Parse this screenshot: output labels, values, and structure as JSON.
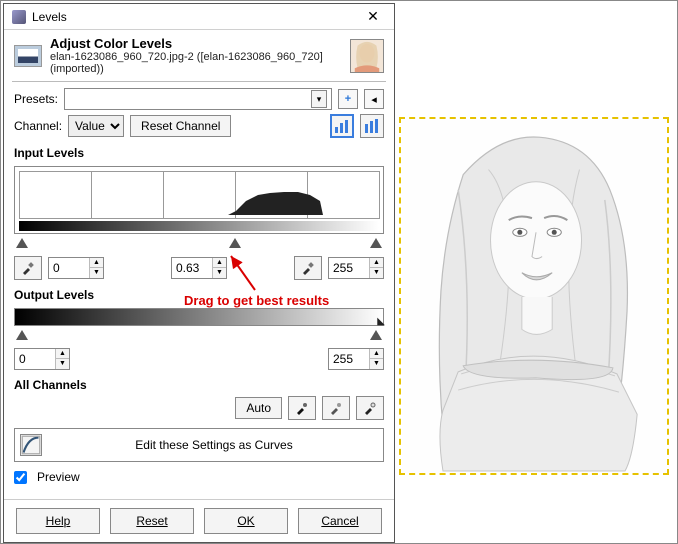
{
  "window": {
    "title": "Levels",
    "big_title": "Adjust Color Levels",
    "subtitle": "elan-1623086_960_720.jpg-2 ([elan-1623086_960_720] (imported))"
  },
  "presets": {
    "label": "Presets:"
  },
  "channel": {
    "label": "Channel:",
    "value": "Value",
    "reset_btn": "Reset Channel"
  },
  "input_levels": {
    "label": "Input Levels",
    "black": "0",
    "gamma": "0.63",
    "white": "255"
  },
  "output_levels": {
    "label": "Output Levels",
    "black": "0",
    "white": "255"
  },
  "all_channels": {
    "label": "All Channels",
    "auto": "Auto"
  },
  "curves_btn": "Edit these Settings as Curves",
  "preview": {
    "label": "Preview"
  },
  "footer": {
    "help": "Help",
    "reset": "Reset",
    "ok": "OK",
    "cancel": "Cancel"
  },
  "annotation": "Drag to get best results"
}
